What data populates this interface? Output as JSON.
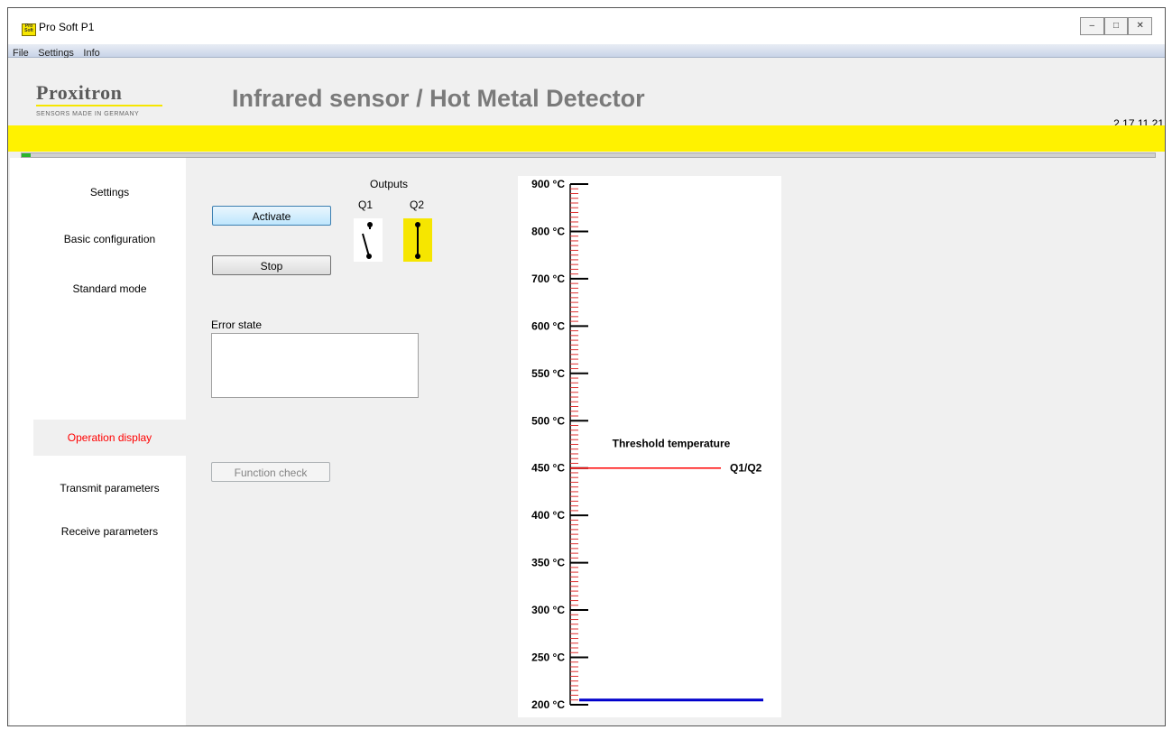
{
  "window": {
    "title": "Pro Soft P1",
    "icon": "app-logo-icon",
    "controls": [
      "minimize-icon",
      "maximize-icon",
      "close-icon"
    ]
  },
  "menu": [
    "File",
    "Settings",
    "Info"
  ],
  "header": {
    "logo_name": "Proxitron",
    "logo_sub": "SENSORS MADE IN GERMANY",
    "title": "Infrared sensor  / Hot Metal Detector",
    "version": "2.17.11.21"
  },
  "progress": {
    "value": 0.008,
    "color": "#2bb52b"
  },
  "sidebar": {
    "items": [
      {
        "label": "Settings",
        "active": false
      },
      {
        "label": "Basic configuration",
        "active": false
      },
      {
        "label": "Standard mode",
        "active": false
      },
      {
        "label": "Operation display",
        "active": true
      },
      {
        "label": "Transmit parameters",
        "active": false
      },
      {
        "label": "Receive parameters",
        "active": false
      }
    ]
  },
  "controls": {
    "activate_label": "Activate",
    "stop_label": "Stop",
    "function_check_label": "Function check",
    "error_label": "Error state",
    "error_value": ""
  },
  "outputs": {
    "title": "Outputs",
    "q1": {
      "label": "Q1",
      "state": "open"
    },
    "q2": {
      "label": "Q2",
      "state": "closed",
      "highlight": "#f6e600"
    }
  },
  "colors": {
    "accent": "#fff200",
    "active_nav": "#ff0000",
    "threshold": "#ff0000",
    "measurement": "#0000cc"
  },
  "chart_data": {
    "type": "scale",
    "ticks": [
      "900 °C",
      "800 °C",
      "700 °C",
      "600 °C",
      "550 °C",
      "500 °C",
      "450 °C",
      "400 °C",
      "350 °C",
      "300 °C",
      "250 °C",
      "200 °C"
    ],
    "tick_positions": [
      0,
      1,
      2,
      3,
      4,
      5,
      6,
      7,
      8,
      9,
      10,
      11
    ],
    "threshold": {
      "label": "Threshold temperature",
      "value": "450 °C",
      "position": 6,
      "output": "Q1/Q2"
    },
    "measurement": {
      "position": 10.9
    }
  }
}
